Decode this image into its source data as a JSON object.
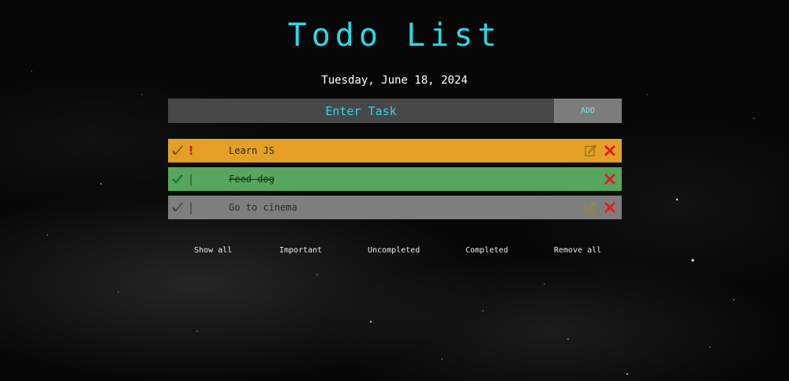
{
  "app": {
    "title": "Todo List",
    "date": "Tuesday, June 18, 2024"
  },
  "input": {
    "placeholder": "Enter Task",
    "add_label": "ADD"
  },
  "tasks": [
    {
      "text": "Learn JS",
      "completed": false,
      "important": true,
      "color": "#e49f26"
    },
    {
      "text": "Feed dog",
      "completed": true,
      "important": false,
      "color": "#57a65e"
    },
    {
      "text": "Go to cinema",
      "completed": false,
      "important": false,
      "color": "#7e7e7e"
    }
  ],
  "filters": [
    {
      "label": "Show all"
    },
    {
      "label": "Important"
    },
    {
      "label": "Uncompleted"
    },
    {
      "label": "Completed"
    },
    {
      "label": "Remove all"
    }
  ],
  "colors": {
    "accent": "#29d9e6",
    "delete": "#e01e1e",
    "important": "#c81e1e",
    "done_check": "#1f7a2c"
  },
  "icons": {
    "check": "check-icon",
    "important": "exclamation-icon",
    "edit": "edit-icon",
    "delete": "close-icon"
  }
}
